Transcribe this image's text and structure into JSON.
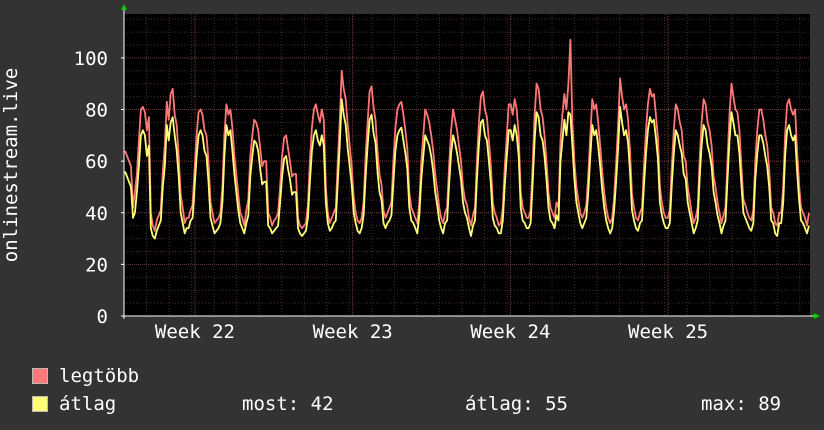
{
  "chart_data": {
    "type": "line",
    "ylabel": "onlinestream.live",
    "ylim": [
      0,
      117
    ],
    "y_ticks": [
      0,
      20,
      40,
      60,
      80,
      100
    ],
    "x_range_weeks": [
      21.55,
      25.9
    ],
    "x_ticks": [
      {
        "label": "Week 22",
        "week": 22
      },
      {
        "label": "Week 23",
        "week": 23
      },
      {
        "label": "Week 24",
        "week": 24
      },
      {
        "label": "Week 25",
        "week": 25
      }
    ],
    "grid": true,
    "legend": "bottom",
    "series": [
      {
        "name": "legtöbb",
        "color": "#ff7777",
        "values": [
          64,
          62,
          60,
          58,
          42,
          48,
          55,
          68,
          80,
          81,
          79,
          72,
          77,
          40,
          35,
          33,
          37,
          39,
          41,
          56,
          66,
          83,
          76,
          86,
          88,
          78,
          74,
          62,
          47,
          42,
          36,
          38,
          38,
          41,
          43,
          57,
          70,
          79,
          80,
          78,
          72,
          70,
          60,
          44,
          40,
          36,
          37,
          38,
          40,
          50,
          70,
          82,
          78,
          80,
          73,
          62,
          55,
          47,
          40,
          38,
          35,
          41,
          45,
          62,
          70,
          76,
          75,
          72,
          65,
          58,
          60,
          60,
          40,
          38,
          35,
          37,
          38,
          40,
          50,
          62,
          69,
          70,
          65,
          60,
          54,
          55,
          55,
          38,
          35,
          34,
          35,
          36,
          43,
          60,
          73,
          80,
          82,
          78,
          75,
          80,
          76,
          50,
          40,
          36,
          38,
          40,
          42,
          60,
          75,
          95,
          88,
          84,
          74,
          66,
          58,
          46,
          40,
          37,
          36,
          38,
          44,
          62,
          75,
          87,
          89,
          81,
          76,
          64,
          55,
          51,
          41,
          38,
          40,
          42,
          44,
          60,
          73,
          80,
          82,
          83,
          78,
          72,
          65,
          48,
          42,
          40,
          38,
          36,
          44,
          60,
          70,
          80,
          78,
          75,
          70,
          64,
          55,
          49,
          42,
          38,
          36,
          40,
          42,
          58,
          72,
          80,
          76,
          72,
          66,
          60,
          50,
          45,
          43,
          38,
          35,
          39,
          42,
          60,
          75,
          85,
          87,
          80,
          77,
          68,
          58,
          44,
          40,
          38,
          35,
          36,
          42,
          58,
          70,
          82,
          82,
          78,
          84,
          80,
          70,
          48,
          42,
          40,
          38,
          38,
          41,
          58,
          78,
          90,
          88,
          80,
          77,
          70,
          60,
          48,
          42,
          40,
          38,
          44,
          42,
          68,
          78,
          86,
          80,
          90,
          107,
          75,
          60,
          50,
          45,
          40,
          38,
          40,
          43,
          55,
          70,
          84,
          80,
          82,
          75,
          66,
          56,
          48,
          42,
          38,
          36,
          38,
          46,
          59,
          74,
          92,
          85,
          80,
          82,
          76,
          64,
          47,
          42,
          38,
          37,
          40,
          42,
          58,
          72,
          82,
          88,
          85,
          86,
          78,
          69,
          50,
          44,
          40,
          38,
          38,
          41,
          58,
          72,
          82,
          80,
          75,
          72,
          62,
          60,
          50,
          45,
          40,
          36,
          38,
          42,
          60,
          75,
          84,
          82,
          75,
          72,
          66,
          54,
          50,
          44,
          40,
          36,
          39,
          42,
          60,
          78,
          90,
          85,
          80,
          79,
          72,
          58,
          45,
          43,
          40,
          38,
          37,
          41,
          60,
          72,
          80,
          80,
          76,
          70,
          66,
          57,
          42,
          40,
          36,
          35,
          40,
          40,
          50,
          70,
          82,
          84,
          80,
          78,
          80,
          64,
          51,
          42,
          40,
          38,
          35,
          40
        ]
      },
      {
        "name": "átlag",
        "color": "#ffff77",
        "values": [
          56,
          54,
          52,
          50,
          38,
          40,
          48,
          58,
          70,
          72,
          70,
          62,
          66,
          34,
          31,
          30,
          33,
          35,
          37,
          50,
          58,
          74,
          68,
          75,
          77,
          70,
          64,
          54,
          40,
          36,
          32,
          34,
          34,
          37,
          38,
          50,
          62,
          70,
          72,
          70,
          64,
          62,
          52,
          38,
          35,
          32,
          33,
          34,
          36,
          44,
          62,
          74,
          70,
          72,
          64,
          55,
          48,
          41,
          36,
          34,
          32,
          36,
          39,
          54,
          62,
          68,
          67,
          64,
          57,
          51,
          52,
          52,
          35,
          34,
          32,
          33,
          34,
          35,
          44,
          54,
          61,
          62,
          57,
          53,
          47,
          48,
          48,
          34,
          32,
          31,
          32,
          33,
          38,
          52,
          64,
          70,
          72,
          68,
          66,
          70,
          66,
          44,
          36,
          33,
          34,
          36,
          37,
          52,
          66,
          84,
          78,
          74,
          65,
          58,
          51,
          40,
          36,
          33,
          32,
          34,
          39,
          54,
          66,
          76,
          78,
          71,
          67,
          56,
          48,
          45,
          36,
          34,
          36,
          37,
          39,
          52,
          64,
          70,
          72,
          73,
          68,
          63,
          57,
          42,
          37,
          36,
          34,
          32,
          39,
          53,
          62,
          70,
          68,
          66,
          62,
          56,
          48,
          43,
          37,
          34,
          32,
          36,
          37,
          51,
          63,
          70,
          67,
          63,
          58,
          53,
          44,
          40,
          38,
          34,
          31,
          35,
          37,
          53,
          66,
          75,
          76,
          70,
          68,
          60,
          51,
          38,
          35,
          34,
          32,
          32,
          37,
          51,
          62,
          72,
          72,
          68,
          74,
          70,
          62,
          42,
          37,
          36,
          34,
          34,
          36,
          51,
          68,
          79,
          77,
          70,
          68,
          62,
          53,
          42,
          37,
          36,
          34,
          39,
          37,
          60,
          68,
          76,
          70,
          79,
          78,
          66,
          53,
          44,
          40,
          36,
          34,
          36,
          38,
          48,
          62,
          74,
          70,
          72,
          66,
          58,
          49,
          42,
          37,
          34,
          32,
          34,
          41,
          52,
          65,
          81,
          75,
          70,
          72,
          67,
          56,
          41,
          37,
          34,
          33,
          36,
          37,
          51,
          63,
          72,
          77,
          75,
          76,
          69,
          61,
          44,
          39,
          36,
          34,
          34,
          36,
          51,
          63,
          72,
          70,
          66,
          63,
          55,
          53,
          44,
          40,
          36,
          32,
          34,
          37,
          53,
          66,
          74,
          72,
          66,
          63,
          58,
          48,
          44,
          39,
          36,
          32,
          35,
          37,
          53,
          68,
          79,
          75,
          70,
          70,
          63,
          51,
          40,
          38,
          36,
          34,
          33,
          36,
          53,
          63,
          70,
          70,
          67,
          62,
          58,
          50,
          37,
          36,
          32,
          31,
          36,
          36,
          44,
          62,
          72,
          74,
          70,
          68,
          70,
          56,
          45,
          37,
          36,
          34,
          32,
          35
        ]
      }
    ]
  },
  "legend": {
    "items": [
      {
        "name": "legtöbb",
        "color": "#ff7777"
      },
      {
        "name": "átlag",
        "color": "#ffff77"
      }
    ],
    "stats": {
      "now_label": "most:",
      "now_value": "42",
      "avg_label": "átlag:",
      "avg_value": "55",
      "max_label": "max:",
      "max_value": "89"
    }
  },
  "colors": {
    "background": "#333333",
    "plot_background": "#000000",
    "grid_minor": "#4a2a2a",
    "grid_major": "#7a3a3a",
    "axis": "#ffffff",
    "arrow": "#00cc00"
  }
}
